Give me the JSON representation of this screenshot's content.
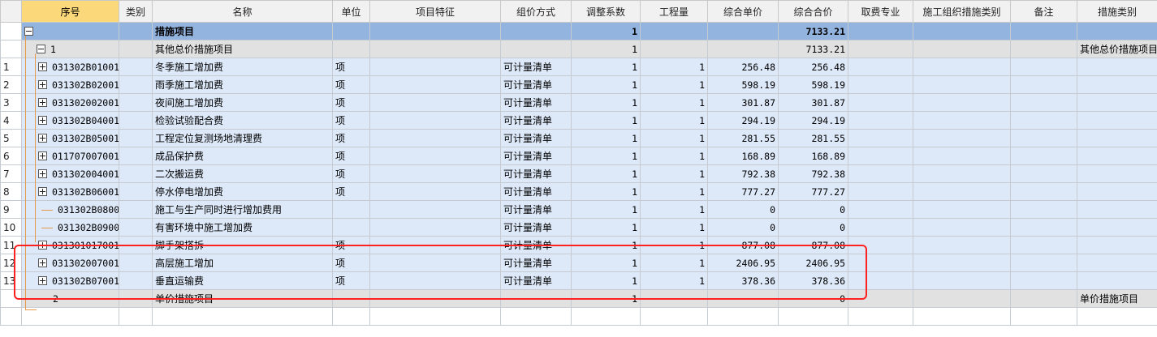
{
  "headers": [
    "",
    "序号",
    "类别",
    "名称",
    "单位",
    "项目特征",
    "组价方式",
    "调整系数",
    "工程量",
    "综合单价",
    "综合合价",
    "取费专业",
    "施工组织措施类别",
    "备注",
    "措施类别"
  ],
  "top": {
    "name": "措施项目",
    "coef": "1",
    "total": "7133.21"
  },
  "group1": {
    "seq": "1",
    "name": "其他总价措施项目",
    "coef": "1",
    "total": "7133.21",
    "category": "其他总价措施项目"
  },
  "rows": [
    {
      "rn": "1",
      "code": "031302B01001",
      "name": "冬季施工增加费",
      "unit": "项",
      "method": "可计量清单",
      "coef": "1",
      "qty": "1",
      "price": "256.48",
      "total": "256.48",
      "expand": true
    },
    {
      "rn": "2",
      "code": "031302B02001",
      "name": "雨季施工增加费",
      "unit": "项",
      "method": "可计量清单",
      "coef": "1",
      "qty": "1",
      "price": "598.19",
      "total": "598.19",
      "expand": true
    },
    {
      "rn": "3",
      "code": "031302002001",
      "name": "夜间施工增加费",
      "unit": "项",
      "method": "可计量清单",
      "coef": "1",
      "qty": "1",
      "price": "301.87",
      "total": "301.87",
      "expand": true
    },
    {
      "rn": "4",
      "code": "031302B04001",
      "name": "检验试验配合费",
      "unit": "项",
      "method": "可计量清单",
      "coef": "1",
      "qty": "1",
      "price": "294.19",
      "total": "294.19",
      "expand": true
    },
    {
      "rn": "5",
      "code": "031302B05001",
      "name": "工程定位复测场地清理费",
      "unit": "项",
      "method": "可计量清单",
      "coef": "1",
      "qty": "1",
      "price": "281.55",
      "total": "281.55",
      "expand": true
    },
    {
      "rn": "6",
      "code": "011707007001",
      "name": "成品保护费",
      "unit": "项",
      "method": "可计量清单",
      "coef": "1",
      "qty": "1",
      "price": "168.89",
      "total": "168.89",
      "expand": true
    },
    {
      "rn": "7",
      "code": "031302004001",
      "name": "二次搬运费",
      "unit": "项",
      "method": "可计量清单",
      "coef": "1",
      "qty": "1",
      "price": "792.38",
      "total": "792.38",
      "expand": true
    },
    {
      "rn": "8",
      "code": "031302B06001",
      "name": "停水停电增加费",
      "unit": "项",
      "method": "可计量清单",
      "coef": "1",
      "qty": "1",
      "price": "777.27",
      "total": "777.27",
      "expand": true
    },
    {
      "rn": "9",
      "code": "031302B08001",
      "name": "施工与生产同时进行增加费用",
      "unit": "",
      "method": "可计量清单",
      "coef": "1",
      "qty": "1",
      "price": "0",
      "total": "0",
      "expand": false
    },
    {
      "rn": "10",
      "code": "031302B09001",
      "name": "有害环境中施工增加费",
      "unit": "",
      "method": "可计量清单",
      "coef": "1",
      "qty": "1",
      "price": "0",
      "total": "0",
      "expand": false
    },
    {
      "rn": "11",
      "code": "031301017001",
      "name": "脚手架搭拆",
      "unit": "项",
      "method": "可计量清单",
      "coef": "1",
      "qty": "1",
      "price": "877.08",
      "total": "877.08",
      "expand": true
    },
    {
      "rn": "12",
      "code": "031302007001",
      "name": "高层施工增加",
      "unit": "项",
      "method": "可计量清单",
      "coef": "1",
      "qty": "1",
      "price": "2406.95",
      "total": "2406.95",
      "expand": true
    },
    {
      "rn": "13",
      "code": "031302B07001",
      "name": "垂直运输费",
      "unit": "项",
      "method": "可计量清单",
      "coef": "1",
      "qty": "1",
      "price": "378.36",
      "total": "378.36",
      "expand": true
    }
  ],
  "group2": {
    "seq": "2",
    "name": "单价措施项目",
    "coef": "1",
    "total": "0",
    "category": "单价措施项目"
  }
}
